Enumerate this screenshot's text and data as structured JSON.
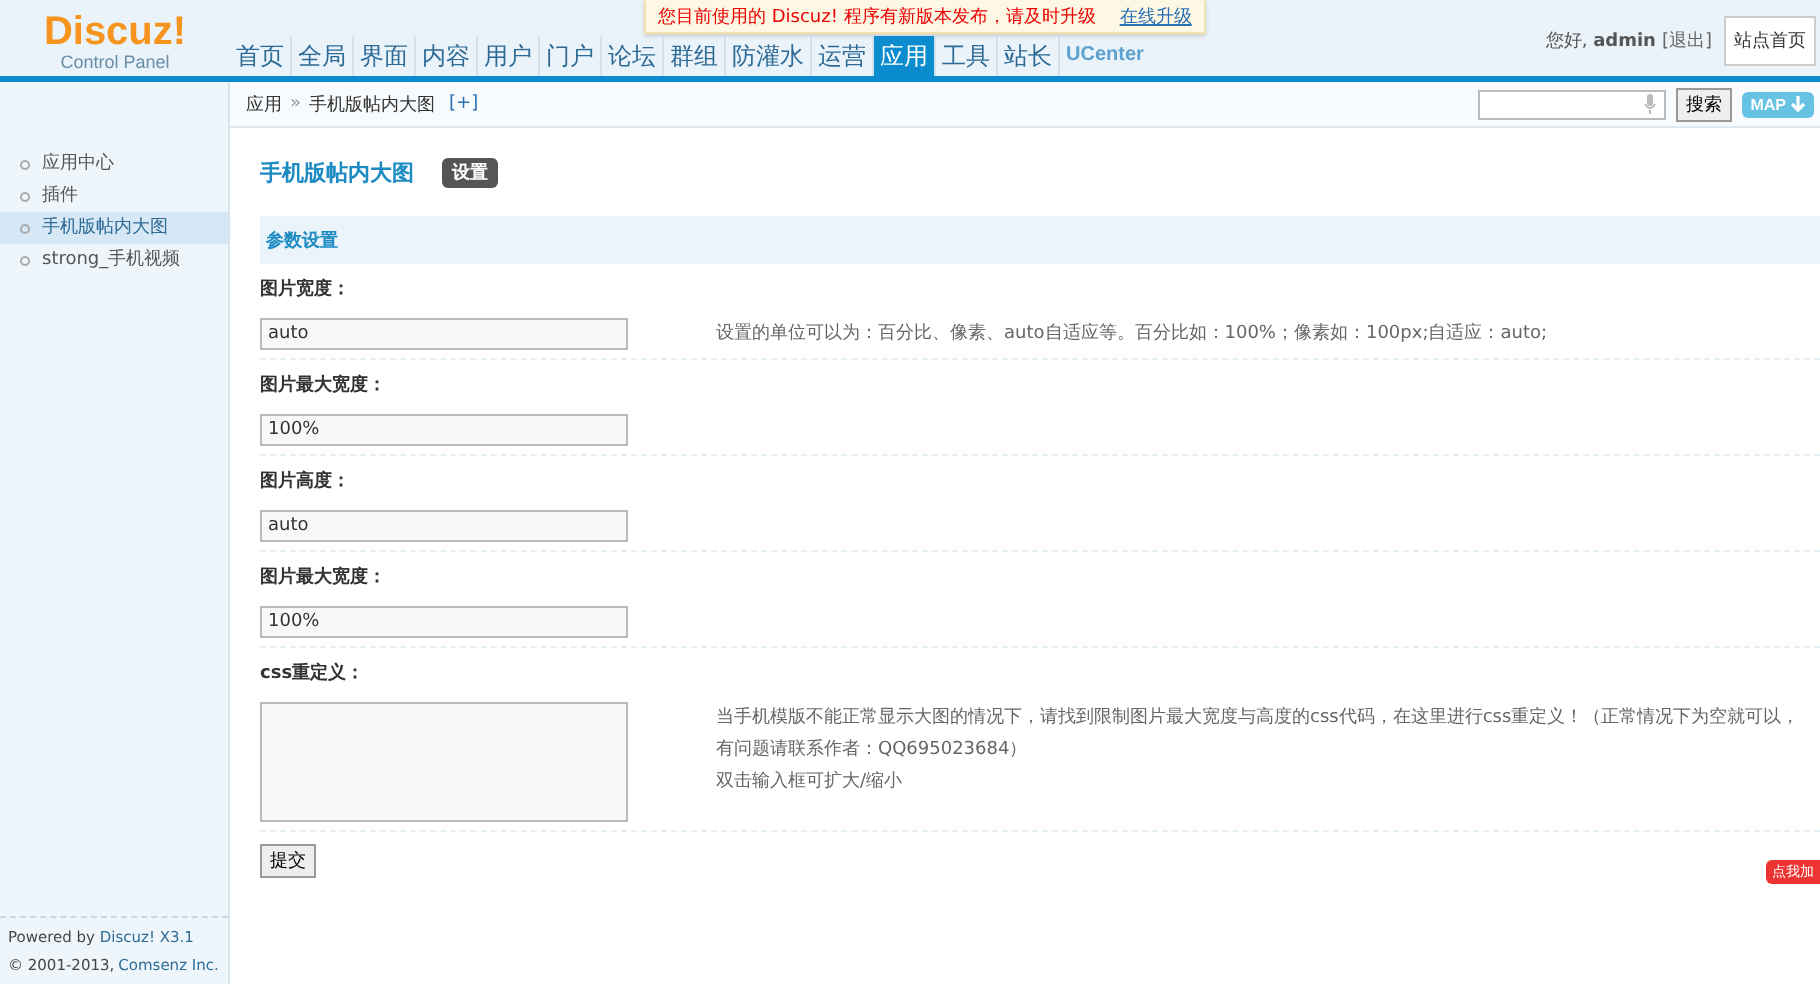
{
  "logo": {
    "name": "Discuz!",
    "subtitle": "Control Panel"
  },
  "notice": {
    "text": "您目前使用的 Discuz! 程序有新版本发布，请及时升级",
    "link": "在线升级"
  },
  "nav": [
    {
      "label": "首页",
      "selected": false
    },
    {
      "label": "全局",
      "selected": false
    },
    {
      "label": "界面",
      "selected": false
    },
    {
      "label": "内容",
      "selected": false
    },
    {
      "label": "用户",
      "selected": false
    },
    {
      "label": "门户",
      "selected": false
    },
    {
      "label": "论坛",
      "selected": false
    },
    {
      "label": "群组",
      "selected": false
    },
    {
      "label": "防灌水",
      "selected": false
    },
    {
      "label": "运营",
      "selected": false
    },
    {
      "label": "应用",
      "selected": true
    },
    {
      "label": "工具",
      "selected": false
    },
    {
      "label": "站长",
      "selected": false
    },
    {
      "label": "UCenter",
      "selected": false
    }
  ],
  "user": {
    "greeting": "您好,",
    "name": "admin",
    "logout": "[退出]",
    "home_button": "站点首页"
  },
  "breadcrumb": {
    "items": [
      "应用",
      "手机版帖内大图"
    ],
    "separator": "»",
    "add": "[+]"
  },
  "search": {
    "button": "搜索",
    "map_button": "MAP"
  },
  "sidebar": {
    "items": [
      {
        "label": "应用中心",
        "selected": false
      },
      {
        "label": "插件",
        "selected": false
      },
      {
        "label": "手机版帖内大图",
        "selected": true
      },
      {
        "label": "strong_手机视频",
        "selected": false
      }
    ],
    "footer": {
      "powered": "Powered by",
      "product": "Discuz! X3.1",
      "copyright": "© 2001-2013,",
      "company": "Comsenz Inc."
    }
  },
  "page": {
    "title": "手机版帖内大图",
    "tab": "设置",
    "section": "参数设置",
    "fields": [
      {
        "kind": "input",
        "label": "图片宽度：",
        "value": "auto",
        "hint": [
          "设置的单位可以为：百分比、像素、auto自适应等。百分比如：100%；像素如：100px;自适应：auto;"
        ]
      },
      {
        "kind": "input",
        "label": "图片最大宽度：",
        "value": "100%"
      },
      {
        "kind": "input",
        "label": "图片高度：",
        "value": "auto"
      },
      {
        "kind": "input",
        "label": "图片最大宽度：",
        "value": "100%"
      },
      {
        "kind": "textarea",
        "label": "css重定义：",
        "hint": [
          "当手机模版不能正常显示大图的情况下，请找到限制图片最大宽度与高度的css代码，在这里进行css重定义！（正常情况下为空就可以，有问题请联系作者：QQ695023684）",
          "双击输入框可扩大/缩小"
        ]
      }
    ],
    "submit": "提交"
  },
  "floating_badge": "点我加"
}
